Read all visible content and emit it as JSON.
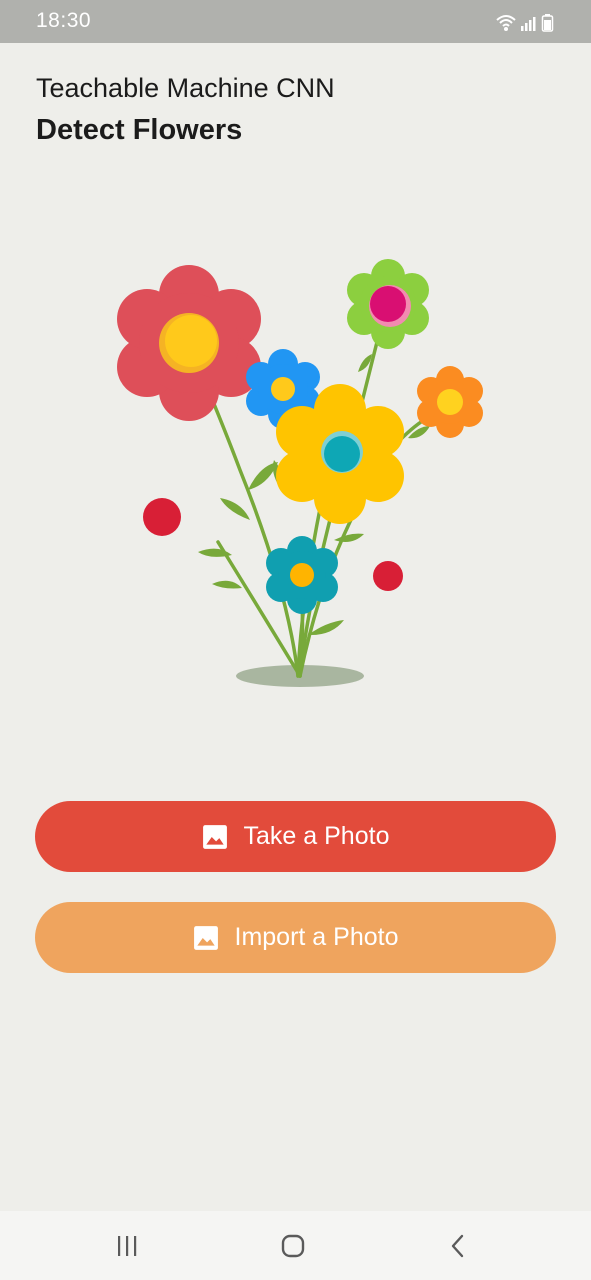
{
  "status_bar": {
    "time": "18:30",
    "icons": [
      "wifi-icon",
      "signal-icon",
      "battery-icon"
    ]
  },
  "header": {
    "subtitle": "Teachable Machine CNN",
    "title": "Detect Flowers"
  },
  "illustration": {
    "icon": "flower-bouquet-illustration"
  },
  "buttons": {
    "take_photo": "Take a Photo",
    "import_photo": "Import a Photo"
  },
  "colors": {
    "take_photo_bg": "#e24b3b",
    "import_photo_bg": "#efa45e",
    "background": "#eeeeea",
    "status_bar_bg": "#b0b1ad"
  },
  "nav_bar": {
    "items": [
      "recent-apps-icon",
      "home-icon",
      "back-icon"
    ]
  }
}
